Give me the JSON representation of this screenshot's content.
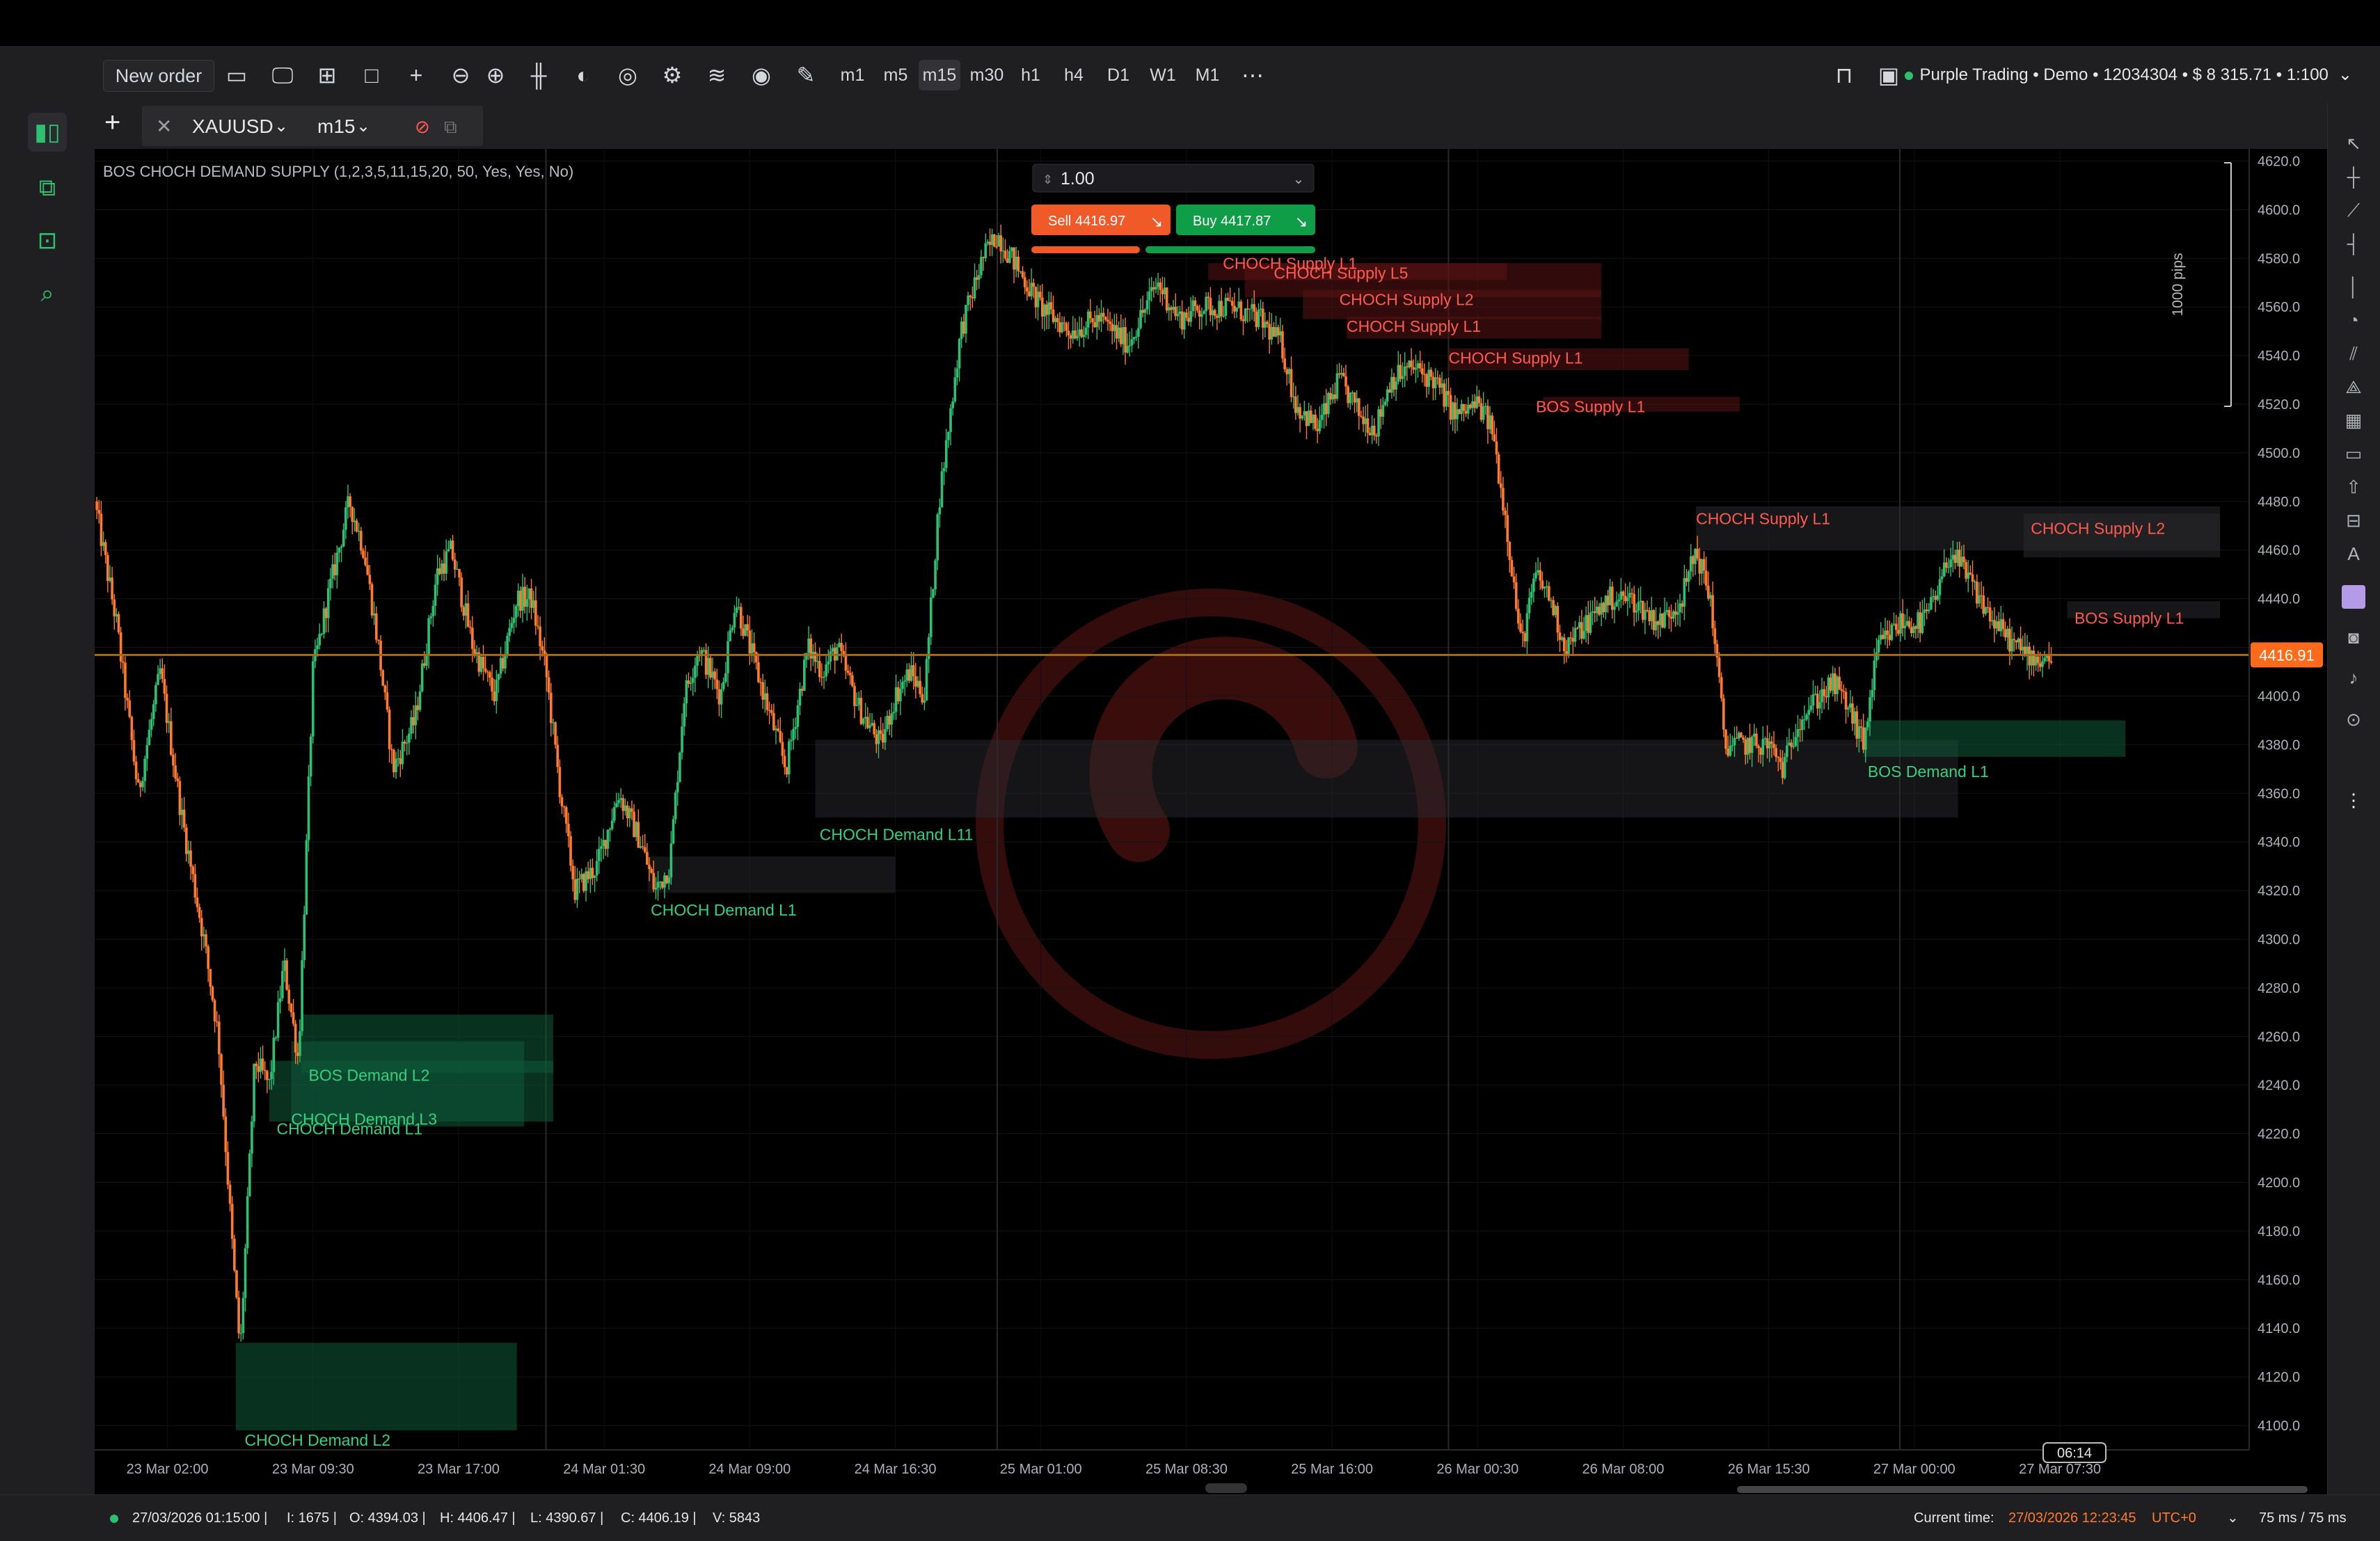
{
  "toolbar": {
    "new_order_label": "New order",
    "timeframes": [
      "m1",
      "m5",
      "m15",
      "m30",
      "h1",
      "h4",
      "D1",
      "W1",
      "M1"
    ],
    "active_timeframe": "m15",
    "account_label": "Purple Trading • Demo • 12034304 • $ 8 315.71 • 1:100"
  },
  "tab": {
    "symbol": "XAUUSD",
    "timeframe": "m15"
  },
  "indicator_label": "BOS CHOCH DEMAND SUPPLY (1,2,3,5,11,15,20, 50, Yes, Yes, No)",
  "trade_panel": {
    "volume": "1.00",
    "sell_label": "Sell 4416.97",
    "buy_label": "Buy 4417.87"
  },
  "pips_label": "1000 pips",
  "current_price": "4416.91",
  "countdown": "06:14",
  "colors": {
    "bull": "#2fbf71",
    "bear": "#ff7a2e",
    "supply_text": "#ff5a4f",
    "demand_text": "#35d17e",
    "price_line": "#a56a1e",
    "price_tag": "#ff6b1a",
    "sell_btn": "#f05a28",
    "buy_btn": "#0f9d48"
  },
  "status": {
    "bar_time": "27/03/2026 01:15:00",
    "index": "I: 1675",
    "open": "O: 4394.03",
    "high": "H: 4406.47",
    "low": "L: 4390.67",
    "close": "C: 4406.19",
    "volume": "V: 5843",
    "current_time_label": "Current time:",
    "current_time": "27/03/2026 12:23:45",
    "timezone": "UTC+0",
    "latency": "75 ms / 75 ms"
  },
  "chart_data": {
    "type": "candlestick",
    "symbol": "XAUUSD",
    "ylim": [
      4090,
      4625
    ],
    "y_ticks": [
      "4620.0",
      "4600.0",
      "4580.0",
      "4560.0",
      "4540.0",
      "4520.0",
      "4500.0",
      "4480.0",
      "4460.0",
      "4440.0",
      "4420.0",
      "4400.0",
      "4380.0",
      "4360.0",
      "4340.0",
      "4320.0",
      "4300.0",
      "4280.0",
      "4260.0",
      "4240.0",
      "4220.0",
      "4200.0",
      "4180.0",
      "4160.0",
      "4140.0",
      "4120.0",
      "4100.0"
    ],
    "x_ticks": [
      "23 Mar 02:00",
      "23 Mar 09:30",
      "23 Mar 17:00",
      "24 Mar 01:30",
      "24 Mar 09:00",
      "24 Mar 16:30",
      "25 Mar 01:00",
      "25 Mar 08:30",
      "25 Mar 16:00",
      "26 Mar 00:30",
      "26 Mar 08:00",
      "26 Mar 15:30",
      "27 Mar 00:00",
      "27 Mar 07:30"
    ],
    "x_range": [
      0,
      14.8
    ],
    "price_path": [
      [
        0.0,
        4480
      ],
      [
        0.15,
        4430
      ],
      [
        0.3,
        4360
      ],
      [
        0.45,
        4410
      ],
      [
        0.6,
        4350
      ],
      [
        0.75,
        4300
      ],
      [
        0.85,
        4260
      ],
      [
        0.95,
        4170
      ],
      [
        1.0,
        4130
      ],
      [
        1.1,
        4250
      ],
      [
        1.2,
        4240
      ],
      [
        1.3,
        4290
      ],
      [
        1.4,
        4250
      ],
      [
        1.5,
        4410
      ],
      [
        1.6,
        4440
      ],
      [
        1.75,
        4480
      ],
      [
        1.85,
        4460
      ],
      [
        1.95,
        4420
      ],
      [
        2.05,
        4370
      ],
      [
        2.2,
        4390
      ],
      [
        2.35,
        4450
      ],
      [
        2.45,
        4460
      ],
      [
        2.6,
        4420
      ],
      [
        2.75,
        4400
      ],
      [
        2.9,
        4440
      ],
      [
        3.0,
        4440
      ],
      [
        3.1,
        4410
      ],
      [
        3.2,
        4360
      ],
      [
        3.3,
        4320
      ],
      [
        3.45,
        4330
      ],
      [
        3.6,
        4360
      ],
      [
        3.75,
        4340
      ],
      [
        3.85,
        4320
      ],
      [
        3.95,
        4330
      ],
      [
        4.05,
        4400
      ],
      [
        4.15,
        4420
      ],
      [
        4.3,
        4400
      ],
      [
        4.4,
        4440
      ],
      [
        4.5,
        4420
      ],
      [
        4.6,
        4400
      ],
      [
        4.75,
        4370
      ],
      [
        4.9,
        4420
      ],
      [
        5.0,
        4410
      ],
      [
        5.1,
        4420
      ],
      [
        5.25,
        4395
      ],
      [
        5.4,
        4380
      ],
      [
        5.5,
        4400
      ],
      [
        5.6,
        4410
      ],
      [
        5.7,
        4400
      ],
      [
        5.8,
        4480
      ],
      [
        5.95,
        4550
      ],
      [
        6.1,
        4580
      ],
      [
        6.2,
        4590
      ],
      [
        6.35,
        4575
      ],
      [
        6.5,
        4560
      ],
      [
        6.7,
        4550
      ],
      [
        6.9,
        4555
      ],
      [
        7.1,
        4545
      ],
      [
        7.3,
        4570
      ],
      [
        7.45,
        4555
      ],
      [
        7.6,
        4560
      ],
      [
        7.8,
        4560
      ],
      [
        8.0,
        4555
      ],
      [
        8.15,
        4545
      ],
      [
        8.25,
        4520
      ],
      [
        8.4,
        4510
      ],
      [
        8.55,
        4530
      ],
      [
        8.7,
        4515
      ],
      [
        8.8,
        4510
      ],
      [
        8.9,
        4530
      ],
      [
        9.05,
        4535
      ],
      [
        9.2,
        4530
      ],
      [
        9.35,
        4515
      ],
      [
        9.5,
        4520
      ],
      [
        9.6,
        4510
      ],
      [
        9.7,
        4470
      ],
      [
        9.8,
        4420
      ],
      [
        9.9,
        4450
      ],
      [
        10.0,
        4440
      ],
      [
        10.1,
        4420
      ],
      [
        10.25,
        4430
      ],
      [
        10.4,
        4440
      ],
      [
        10.55,
        4440
      ],
      [
        10.75,
        4430
      ],
      [
        10.9,
        4440
      ],
      [
        11.0,
        4460
      ],
      [
        11.1,
        4440
      ],
      [
        11.2,
        4380
      ],
      [
        11.35,
        4380
      ],
      [
        11.5,
        4380
      ],
      [
        11.6,
        4370
      ],
      [
        11.7,
        4390
      ],
      [
        11.85,
        4400
      ],
      [
        11.95,
        4405
      ],
      [
        12.05,
        4395
      ],
      [
        12.15,
        4380
      ],
      [
        12.25,
        4420
      ],
      [
        12.4,
        4430
      ],
      [
        12.55,
        4430
      ],
      [
        12.65,
        4440
      ],
      [
        12.75,
        4460
      ],
      [
        12.85,
        4450
      ],
      [
        12.95,
        4440
      ],
      [
        13.05,
        4430
      ],
      [
        13.2,
        4420
      ],
      [
        13.35,
        4415
      ],
      [
        13.45,
        4417
      ]
    ],
    "zones": [
      {
        "label": "CHOCH Supply L1",
        "kind": "supply",
        "x1": 7.65,
        "x2": 9.7,
        "y1": 4571,
        "y2": 4578,
        "lx": 7.75,
        "ly": 4578
      },
      {
        "label": "CHOCH Supply L5",
        "kind": "supply",
        "x1": 7.9,
        "x2": 10.35,
        "y1": 4564,
        "y2": 4578,
        "lx": 8.1,
        "ly": 4574
      },
      {
        "label": "CHOCH Supply L2",
        "kind": "supply",
        "x1": 8.3,
        "x2": 10.35,
        "y1": 4555,
        "y2": 4567,
        "lx": 8.55,
        "ly": 4563
      },
      {
        "label": "CHOCH Supply L1",
        "kind": "supply",
        "x1": 8.6,
        "x2": 10.35,
        "y1": 4547,
        "y2": 4556,
        "lx": 8.6,
        "ly": 4552
      },
      {
        "label": "CHOCH Supply L1",
        "kind": "supply",
        "x1": 9.3,
        "x2": 10.95,
        "y1": 4534,
        "y2": 4543,
        "lx": 9.3,
        "ly": 4539
      },
      {
        "label": "BOS Supply L1",
        "kind": "supply",
        "x1": 9.95,
        "x2": 11.3,
        "y1": 4517,
        "y2": 4523,
        "lx": 9.9,
        "ly": 4519
      },
      {
        "label": "CHOCH Supply L1",
        "kind": "supply_gray",
        "x1": 11.0,
        "x2": 14.6,
        "y1": 4460,
        "y2": 4478,
        "lx": 11.0,
        "ly": 4473
      },
      {
        "label": "CHOCH Supply L2",
        "kind": "supply_gray",
        "x1": 13.25,
        "x2": 14.6,
        "y1": 4457,
        "y2": 4475,
        "lx": 13.3,
        "ly": 4469
      },
      {
        "label": "BOS Supply L1",
        "kind": "supply_gray",
        "x1": 13.55,
        "x2": 14.6,
        "y1": 4432,
        "y2": 4439,
        "lx": 13.6,
        "ly": 4432
      },
      {
        "label": "CHOCH Demand L2",
        "kind": "demand",
        "x1": 0.97,
        "x2": 2.9,
        "y1": 4098,
        "y2": 4134,
        "lx": 1.03,
        "ly": 4094
      },
      {
        "label": "BOS Demand L2",
        "kind": "demand",
        "x1": 1.42,
        "x2": 3.15,
        "y1": 4245,
        "y2": 4269,
        "lx": 1.47,
        "ly": 4244
      },
      {
        "label": "CHOCH Demand L3",
        "kind": "demand",
        "x1": 1.35,
        "x2": 2.95,
        "y1": 4223,
        "y2": 4258,
        "lx": 1.35,
        "ly": 4226
      },
      {
        "label": "CHOCH Demand L1",
        "kind": "demand",
        "x1": 1.2,
        "x2": 3.15,
        "y1": 4225,
        "y2": 4250,
        "lx": 1.25,
        "ly": 4222
      },
      {
        "label": "CHOCH Demand L1",
        "kind": "demand_gray",
        "x1": 3.8,
        "x2": 5.5,
        "y1": 4319,
        "y2": 4334,
        "lx": 3.82,
        "ly": 4312
      },
      {
        "label": "CHOCH Demand L11",
        "kind": "demand_gray",
        "x1": 4.95,
        "x2": 12.8,
        "y1": 4350,
        "y2": 4382,
        "lx": 4.98,
        "ly": 4343
      },
      {
        "label": "BOS Demand L1",
        "kind": "demand",
        "x1": 12.15,
        "x2": 13.95,
        "y1": 4375,
        "y2": 4390,
        "lx": 12.18,
        "ly": 4369
      }
    ]
  }
}
